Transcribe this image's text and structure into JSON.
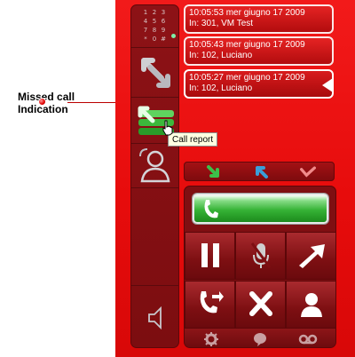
{
  "annotation": {
    "label": "Missed call\nIndication"
  },
  "tooltip": {
    "text": "Call report"
  },
  "sidebar": {
    "items": [
      {
        "name": "keypad",
        "icon": "keypad-icon",
        "digits": [
          "1",
          "2",
          "3",
          "4",
          "5",
          "6",
          "7",
          "8",
          "9",
          "*",
          "0",
          "#"
        ]
      },
      {
        "name": "transfer",
        "icon": "transfer-arrows-icon"
      },
      {
        "name": "call-report",
        "icon": "call-log-icon",
        "missed_indicator": true
      },
      {
        "name": "contact",
        "icon": "contact-icon"
      },
      {
        "name": "volume",
        "icon": "speaker-icon"
      }
    ]
  },
  "call_log": {
    "entries": [
      {
        "time": "10:05:53 mer giugno 17 2009",
        "detail": "In: 301, VM Test"
      },
      {
        "time": "10:05:43 mer giugno 17 2009",
        "detail": "In: 102, Luciano"
      },
      {
        "time": "10:05:27 mer giugno 17 2009",
        "detail": "In: 102, Luciano",
        "selected": true
      }
    ]
  },
  "filter_icons": [
    "incoming-call-icon",
    "outgoing-call-icon",
    "missed-call-icon"
  ],
  "controls": {
    "call_button": "phone-icon",
    "buttons": [
      "pause-icon",
      "mute-mic-icon",
      "forward-arrow-icon",
      "transfer-call-icon",
      "hangup-x-icon",
      "person-icon"
    ],
    "bottom": [
      "settings-icon",
      "chat-icon",
      "voicemail-icon"
    ]
  },
  "colors": {
    "background": "#e70c0c",
    "panel": "#7f0f12",
    "call_green": "#36b336",
    "entry": "#c5161a"
  }
}
